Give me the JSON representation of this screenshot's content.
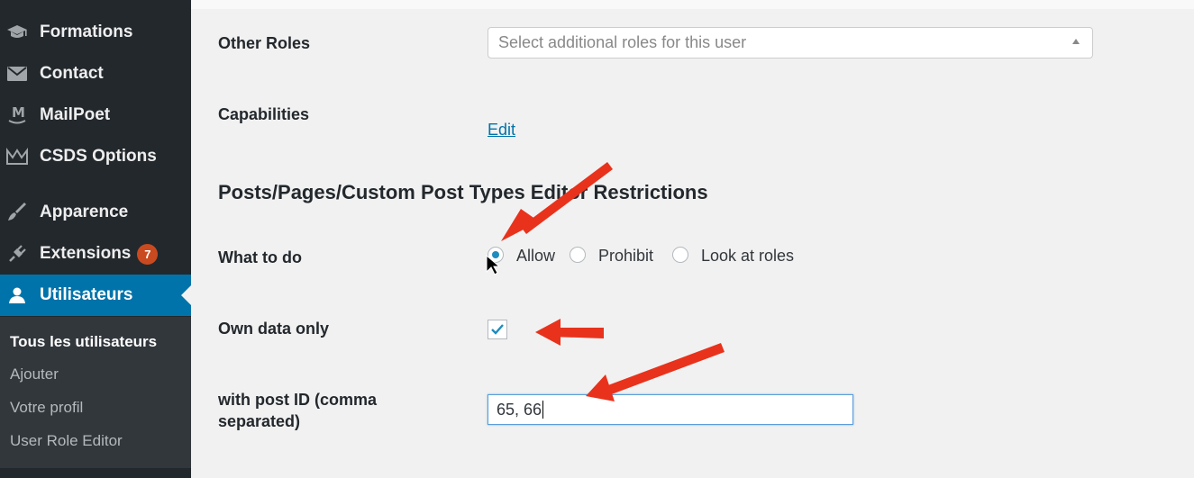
{
  "sidebar": {
    "items": [
      {
        "label": "Formations",
        "icon": "graduation-cap-icon"
      },
      {
        "label": "Contact",
        "icon": "envelope-icon"
      },
      {
        "label": "MailPoet",
        "icon": "mailpoet-icon"
      },
      {
        "label": "CSDS Options",
        "icon": "crown-icon"
      },
      {
        "label": "Apparence",
        "icon": "paintbrush-icon"
      },
      {
        "label": "Extensions",
        "icon": "plugin-icon",
        "badge": "7"
      },
      {
        "label": "Utilisateurs",
        "icon": "user-icon",
        "active": true
      }
    ],
    "submenu": [
      {
        "label": "Tous les utilisateurs",
        "current": true
      },
      {
        "label": "Ajouter"
      },
      {
        "label": "Votre profil"
      },
      {
        "label": "User Role Editor"
      }
    ]
  },
  "form": {
    "other_roles_label": "Other Roles",
    "other_roles_placeholder": "Select additional roles for this user",
    "capabilities_label": "Capabilities",
    "capabilities_link": "Edit",
    "section_title": "Posts/Pages/Custom Post Types Editor Restrictions",
    "what_to_do_label": "What to do",
    "options": [
      "Allow",
      "Prohibit",
      "Look at roles"
    ],
    "selected_option": "Allow",
    "own_data_label": "Own data only",
    "own_data_checked": true,
    "post_id_label_line1": "with post ID (comma",
    "post_id_label_line2": "separated)",
    "post_id_value": "65, 66"
  },
  "colors": {
    "sidebar_bg": "#23282d",
    "active_bg": "#0073aa",
    "link": "#0073aa",
    "arrow": "#e8321c"
  }
}
